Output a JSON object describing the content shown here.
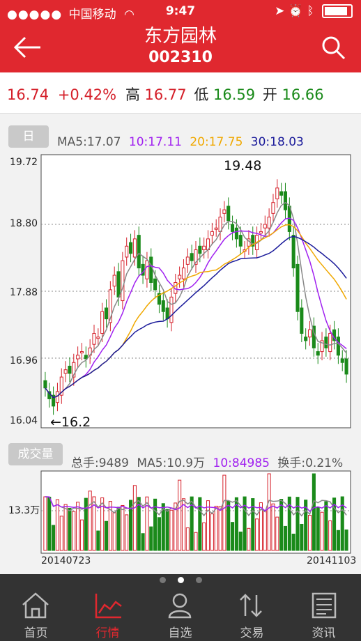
{
  "status_bar": {
    "signal_dots": "●●●●●",
    "carrier": "中国移动",
    "time": "9:47",
    "battery_level": 0.9
  },
  "header": {
    "title": "东方园林",
    "code": "002310"
  },
  "quote": {
    "price": "16.74",
    "change": "+0.42%",
    "high_label": "高",
    "high": "16.77",
    "low_label": "低",
    "low": "16.59",
    "open_label": "开",
    "open": "16.66"
  },
  "kline": {
    "period_tab": "日",
    "ma5": "MA5:17.07",
    "ma10": "10:17.11",
    "ma20": "20:17.75",
    "ma30": "30:18.03",
    "y_ticks": [
      "19.72",
      "18.80",
      "17.88",
      "16.96",
      "16.04"
    ],
    "max_label": "19.48",
    "min_label": "←16.2"
  },
  "volume": {
    "tab": "成交量",
    "total": "总手:9489",
    "ma5": "MA5:10.9万",
    "ma10": "10:84985",
    "turnover": "换手:0.21%",
    "y_tick": "13.3万",
    "start_date": "20140723",
    "end_date": "20141103"
  },
  "pager": {
    "count": 3,
    "active": 1
  },
  "tabs": [
    {
      "label": "首页",
      "icon": "home-icon"
    },
    {
      "label": "行情",
      "icon": "chart-icon",
      "active": true
    },
    {
      "label": "自选",
      "icon": "person-icon"
    },
    {
      "label": "交易",
      "icon": "transfer-icon"
    },
    {
      "label": "资讯",
      "icon": "news-icon"
    }
  ],
  "colors": {
    "brand": "#e0282f",
    "up": "#d5202a",
    "down": "#1a8a1a",
    "ma5": "#888888",
    "ma10": "#a020f0",
    "ma20": "#f0a800",
    "ma30": "#1a1a9a"
  },
  "chart_data": {
    "type": "candlestick",
    "x_start": "20140723",
    "x_end": "20141103",
    "ylim": [
      16.04,
      19.72
    ],
    "labeled_high": 19.48,
    "labeled_low": 16.2,
    "close_series": [
      16.55,
      16.4,
      16.3,
      16.5,
      16.7,
      16.8,
      16.75,
      16.9,
      17.0,
      17.05,
      16.95,
      17.1,
      17.3,
      17.25,
      17.6,
      17.5,
      17.9,
      18.1,
      17.8,
      18.3,
      18.5,
      18.4,
      18.6,
      18.2,
      18.1,
      18.3,
      18.0,
      17.9,
      17.7,
      17.6,
      17.5,
      17.8,
      18.0,
      18.1,
      18.2,
      18.35,
      18.3,
      18.45,
      18.4,
      18.5,
      18.6,
      18.7,
      18.75,
      18.9,
      19.0,
      18.85,
      18.7,
      18.6,
      18.5,
      18.45,
      18.6,
      18.5,
      18.65,
      18.7,
      18.8,
      18.9,
      19.1,
      19.3,
      19.2,
      19.0,
      18.7,
      18.2,
      17.6,
      17.3,
      17.2,
      17.35,
      17.1,
      17.0,
      17.2,
      17.1,
      17.3,
      17.2,
      17.0,
      16.9,
      16.74
    ],
    "volume_max_label": "13.3万"
  }
}
